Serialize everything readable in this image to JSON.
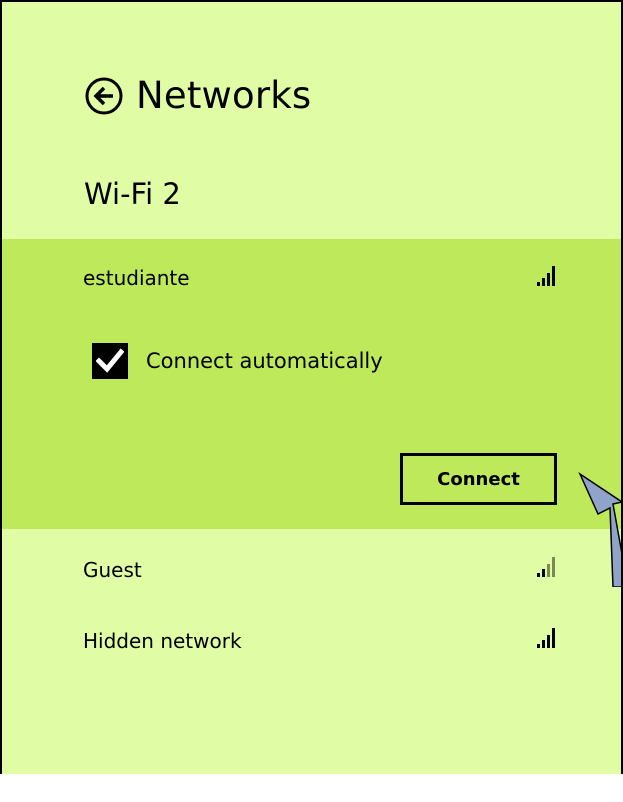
{
  "header": {
    "title": "Networks",
    "back_icon": "back-arrow-circle-icon"
  },
  "section": {
    "title": "Wi-Fi 2"
  },
  "selected_network": {
    "name": "estudiante",
    "signal_icon": "signal-strength-icon",
    "auto_connect_label": "Connect automatically",
    "auto_connect_checked": true,
    "connect_label": "Connect"
  },
  "networks": [
    {
      "name": "Guest",
      "signal_icon": "signal-strength-icon"
    },
    {
      "name": "Hidden network",
      "signal_icon": "signal-strength-icon"
    }
  ],
  "colors": {
    "panel_background": "#e0fca4",
    "selected_background": "#bde95a",
    "pointer_arrow": "#8fa4c8"
  }
}
